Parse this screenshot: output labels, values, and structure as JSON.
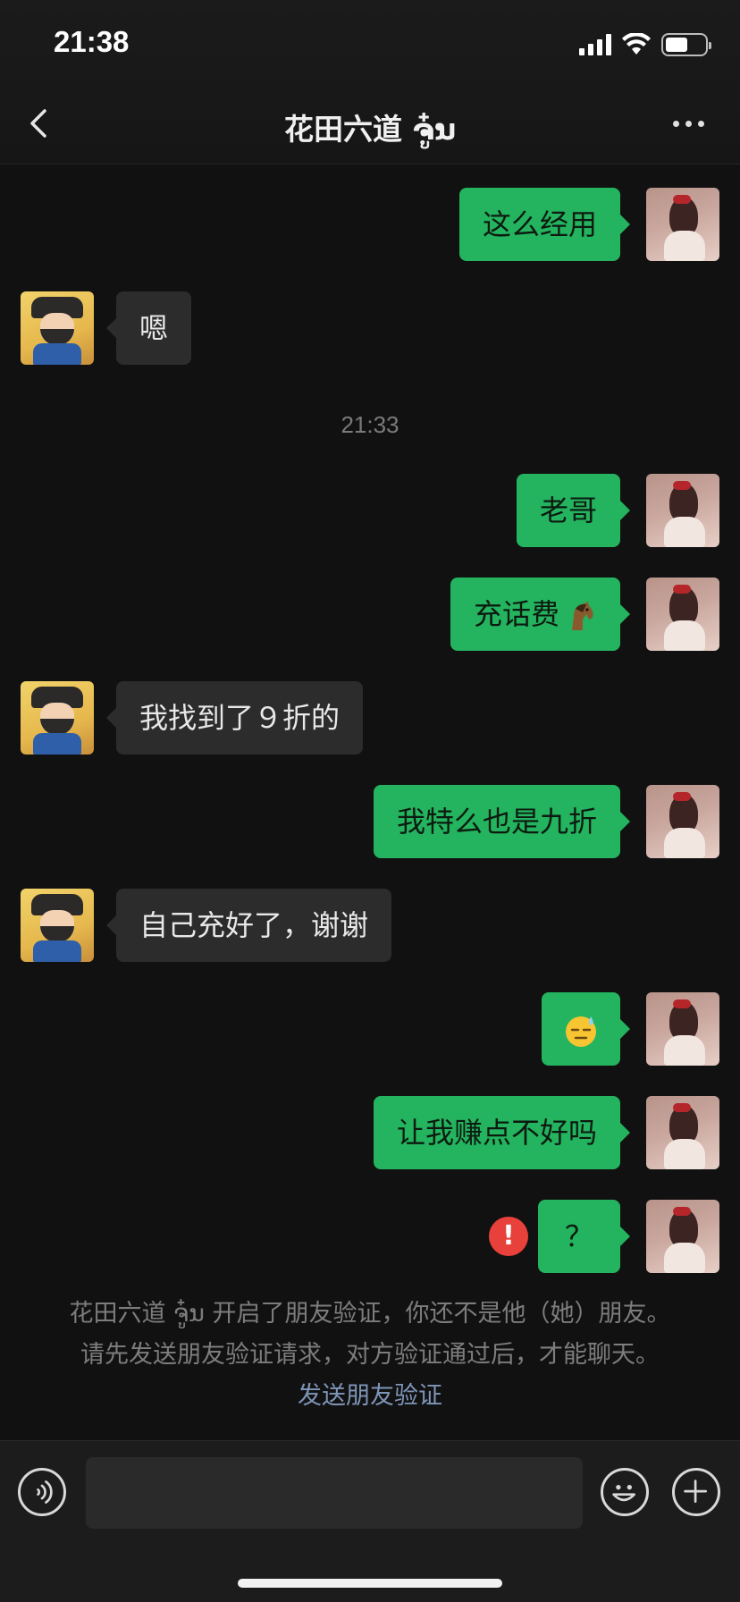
{
  "status_bar": {
    "time": "21:38"
  },
  "header": {
    "title": "花田六道 ຈູ໋ນ"
  },
  "messages": [
    {
      "from": "me",
      "text": "这么经用"
    },
    {
      "from": "them",
      "text": "嗯"
    },
    {
      "from": "me",
      "text": "老哥"
    },
    {
      "from": "me",
      "text": "充话费",
      "emoji": "horse"
    },
    {
      "from": "them",
      "text": "我找到了９折的"
    },
    {
      "from": "me",
      "text": "我特么也是九折"
    },
    {
      "from": "them",
      "text": "自己充好了，谢谢"
    },
    {
      "from": "me",
      "text": "",
      "emoji": "sweat-face"
    },
    {
      "from": "me",
      "text": "让我赚点不好吗"
    },
    {
      "from": "me",
      "text": "？",
      "failed": true
    }
  ],
  "timestamp": "21:33",
  "error_icon_text": "!",
  "system_notice": {
    "line1": "花田六道 ຈູ໋ນ 开启了朋友验证，你还不是他（她）朋友。",
    "line2": "请先发送朋友验证请求，对方验证通过后，才能聊天。",
    "link": "发送朋友验证"
  },
  "input_bar": {
    "value": "",
    "placeholder": ""
  },
  "colors": {
    "my_bubble": "#24b35e",
    "their_bubble": "#2c2c2c",
    "background": "#111111",
    "error": "#e8413b",
    "link": "#7f95b8"
  }
}
